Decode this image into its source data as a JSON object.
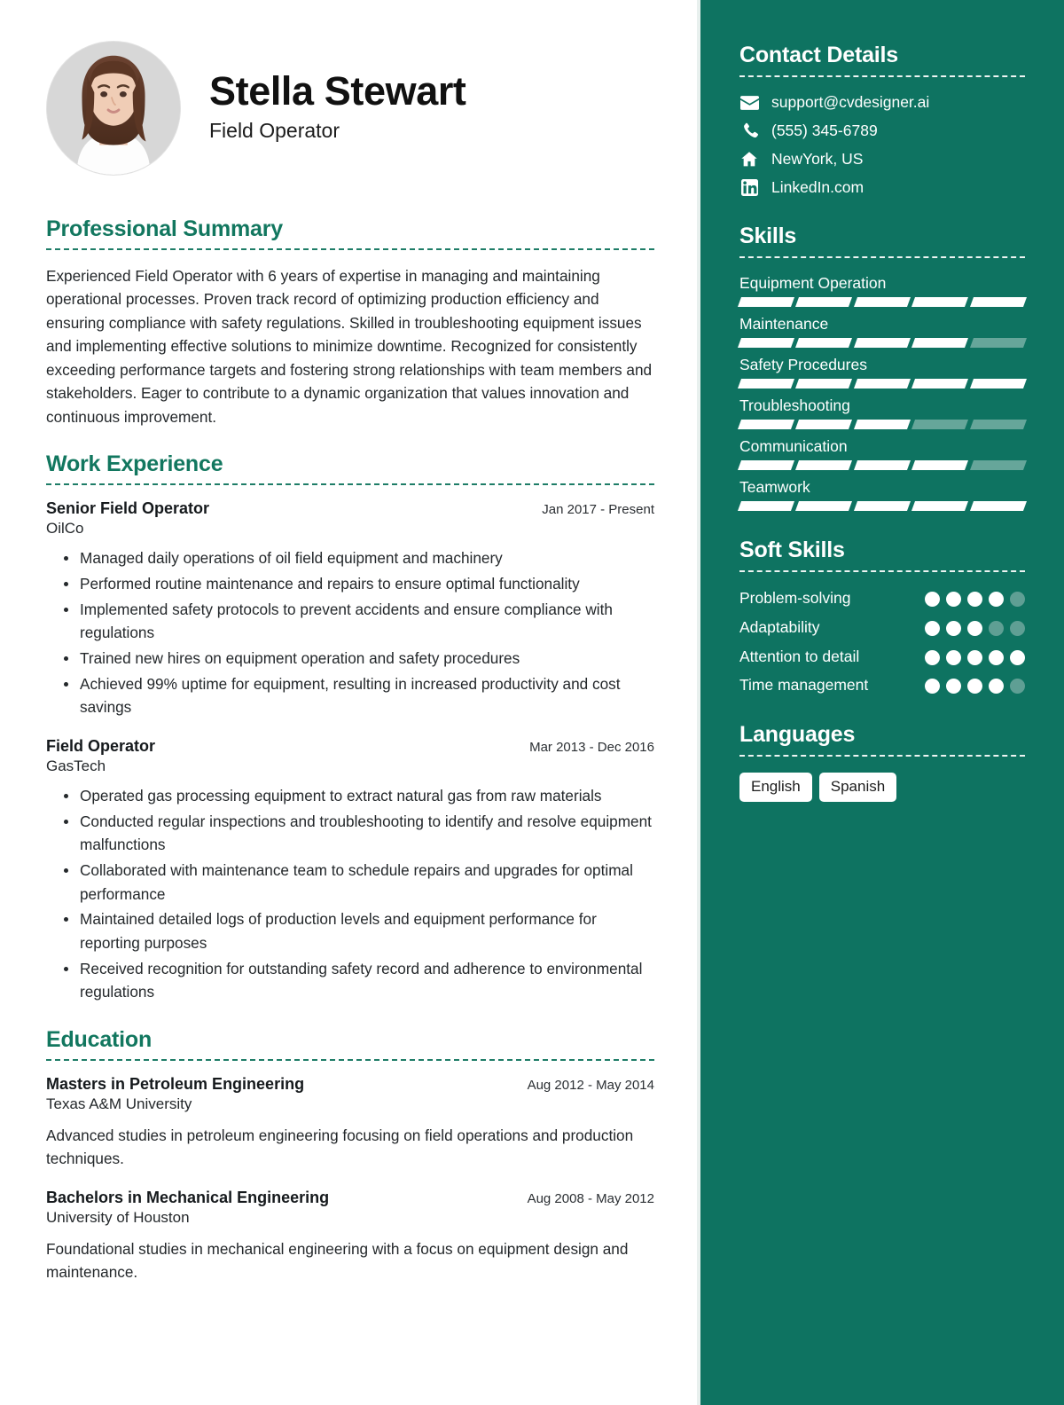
{
  "header": {
    "name": "Stella Stewart",
    "title": "Field Operator",
    "avatar_icon": "portrait-photo"
  },
  "theme": {
    "accent_teal": "#12775f",
    "sidebar_bg": "#0e7361",
    "segment_off": "#66a69a",
    "dot_off": "#5f9f94",
    "body_text": "#24282b"
  },
  "sections": {
    "summary": {
      "heading": "Professional Summary",
      "text": "Experienced Field Operator with 6 years of expertise in managing and maintaining operational processes. Proven track record of optimizing production efficiency and ensuring compliance with safety regulations. Skilled in troubleshooting equipment issues and implementing effective solutions to minimize downtime. Recognized for consistently exceeding performance targets and fostering strong relationships with team members and stakeholders. Eager to contribute to a dynamic organization that values innovation and continuous improvement."
    },
    "experience": {
      "heading": "Work Experience",
      "entries": [
        {
          "role": "Senior Field Operator",
          "org": "OilCo",
          "date": "Jan 2017 - Present",
          "bullets": [
            "Managed daily operations of oil field equipment and machinery",
            "Performed routine maintenance and repairs to ensure optimal functionality",
            "Implemented safety protocols to prevent accidents and ensure compliance with regulations",
            "Trained new hires on equipment operation and safety procedures",
            "Achieved 99% uptime for equipment, resulting in increased productivity and cost savings"
          ]
        },
        {
          "role": "Field Operator",
          "org": "GasTech",
          "date": "Mar 2013 - Dec 2016",
          "bullets": [
            "Operated gas processing equipment to extract natural gas from raw materials",
            "Conducted regular inspections and troubleshooting to identify and resolve equipment malfunctions",
            "Collaborated with maintenance team to schedule repairs and upgrades for optimal performance",
            "Maintained detailed logs of production levels and equipment performance for reporting purposes",
            "Received recognition for outstanding safety record and adherence to environmental regulations"
          ]
        }
      ]
    },
    "education": {
      "heading": "Education",
      "entries": [
        {
          "degree": "Masters in Petroleum Engineering",
          "school": "Texas A&M University",
          "date": "Aug 2012 - May 2014",
          "description": "Advanced studies in petroleum engineering focusing on field operations and production techniques."
        },
        {
          "degree": "Bachelors in Mechanical Engineering",
          "school": "University of Houston",
          "date": "Aug 2008 - May 2012",
          "description": "Foundational studies in mechanical engineering with a focus on equipment design and maintenance."
        }
      ]
    }
  },
  "sidebar": {
    "contact": {
      "heading": "Contact Details",
      "items": [
        {
          "icon": "envelope-icon",
          "value": "support@cvdesigner.ai"
        },
        {
          "icon": "phone-icon",
          "value": "(555) 345-6789"
        },
        {
          "icon": "home-icon",
          "value": "NewYork, US"
        },
        {
          "icon": "linkedin-icon",
          "value": "LinkedIn.com"
        }
      ]
    },
    "skills": {
      "heading": "Skills",
      "max_level": 5,
      "items": [
        {
          "name": "Equipment Operation",
          "level": 5
        },
        {
          "name": "Maintenance",
          "level": 4
        },
        {
          "name": "Safety Procedures",
          "level": 5
        },
        {
          "name": "Troubleshooting",
          "level": 3
        },
        {
          "name": "Communication",
          "level": 4
        },
        {
          "name": "Teamwork",
          "level": 5
        }
      ]
    },
    "soft_skills": {
      "heading": "Soft Skills",
      "max_level": 5,
      "items": [
        {
          "name": "Problem-solving",
          "level": 4
        },
        {
          "name": "Adaptability",
          "level": 3
        },
        {
          "name": "Attention to detail",
          "level": 5
        },
        {
          "name": "Time management",
          "level": 4
        }
      ]
    },
    "languages": {
      "heading": "Languages",
      "items": [
        "English",
        "Spanish"
      ]
    }
  }
}
